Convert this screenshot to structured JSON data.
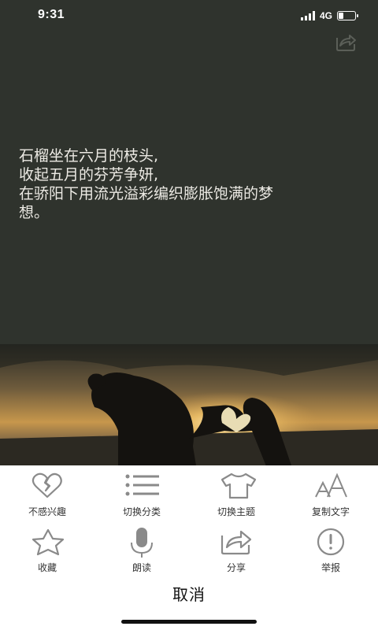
{
  "status_bar": {
    "time": "9:31",
    "network": "4G",
    "battery_level": 0.35
  },
  "poem": {
    "lines": [
      " 石榴坐在六月的枝头,",
      "收起五月的芬芳争妍,",
      "在骄阳下用流光溢彩编织膨胀饱满的梦",
      "想。"
    ]
  },
  "actions": {
    "row1": [
      {
        "label": "不感兴趣",
        "icon": "broken-heart-icon"
      },
      {
        "label": "切换分类",
        "icon": "list-icon"
      },
      {
        "label": "切换主题",
        "icon": "tshirt-icon"
      },
      {
        "label": "复制文字",
        "icon": "font-size-icon"
      }
    ],
    "row2": [
      {
        "label": "收藏",
        "icon": "star-icon"
      },
      {
        "label": "朗读",
        "icon": "microphone-icon"
      },
      {
        "label": "分享",
        "icon": "share-icon"
      },
      {
        "label": "举报",
        "icon": "report-icon"
      }
    ]
  },
  "cancel_label": "取消",
  "colors": {
    "background": "#2f332d",
    "sheet": "#ffffff",
    "icon_gray": "#8a8a8a"
  }
}
